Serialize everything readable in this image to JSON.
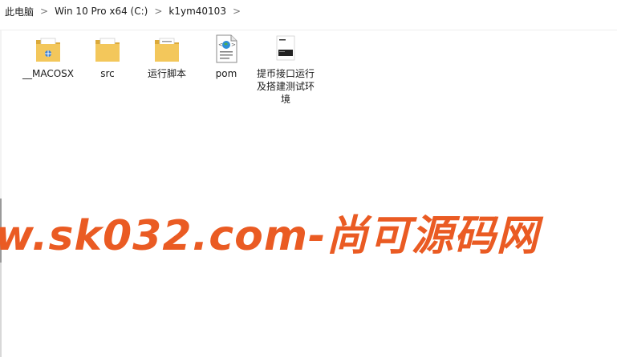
{
  "breadcrumb": {
    "items": [
      "此电脑",
      "Win 10 Pro x64 (C:)",
      "k1ym40103"
    ],
    "separator": ">"
  },
  "files": [
    {
      "name": "__MACOSX",
      "icon": "folder-icon"
    },
    {
      "name": "src",
      "icon": "folder-icon"
    },
    {
      "name": "运行脚本",
      "icon": "folder-icon"
    },
    {
      "name": "pom",
      "icon": "xml-file-icon"
    },
    {
      "name": "提币接口运行及搭建测试环境",
      "icon": "image-file-icon"
    }
  ],
  "watermark": {
    "text": "w.sk032.com-尚可源码网",
    "color": "#ea5b23"
  },
  "colors": {
    "folder": "#f3c75b",
    "folder_back": "#dcaa39",
    "watermark": "#ea5b23"
  }
}
